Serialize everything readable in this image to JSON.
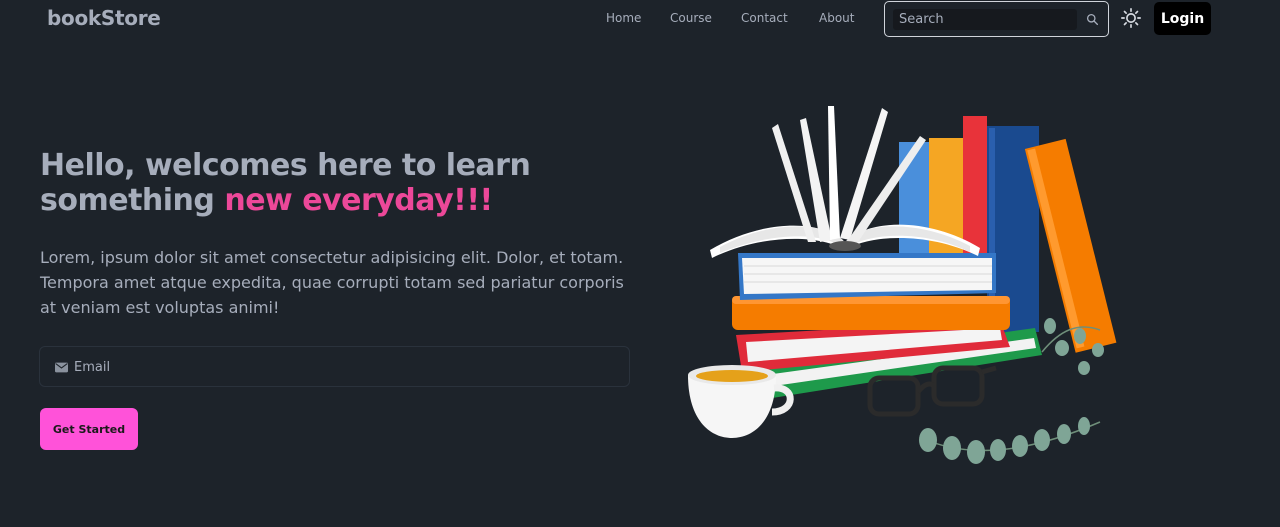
{
  "navbar": {
    "logo": "bookStore",
    "links": [
      "Home",
      "Course",
      "Contact",
      "About"
    ],
    "search_placeholder": "Search",
    "login_label": "Login"
  },
  "hero": {
    "title_line1": "Hello, welcomes here to learn",
    "title_line2_prefix": "something ",
    "title_accent": "new everyday!!!",
    "description": "Lorem, ipsum dolor sit amet consectetur adipisicing elit. Dolor, et totam. Tempora amet atque expedita, quae corrupti totam sed pariatur corporis at veniam est voluptas animi!",
    "email_placeholder": "Email",
    "cta_label": "Get Started"
  },
  "icons": {
    "search": "search-icon",
    "theme": "sun-icon",
    "mail": "mail-icon"
  },
  "colors": {
    "background": "#1d232a",
    "accent": "#ec4899",
    "cta": "#ff52d9",
    "login_bg": "#000000"
  }
}
